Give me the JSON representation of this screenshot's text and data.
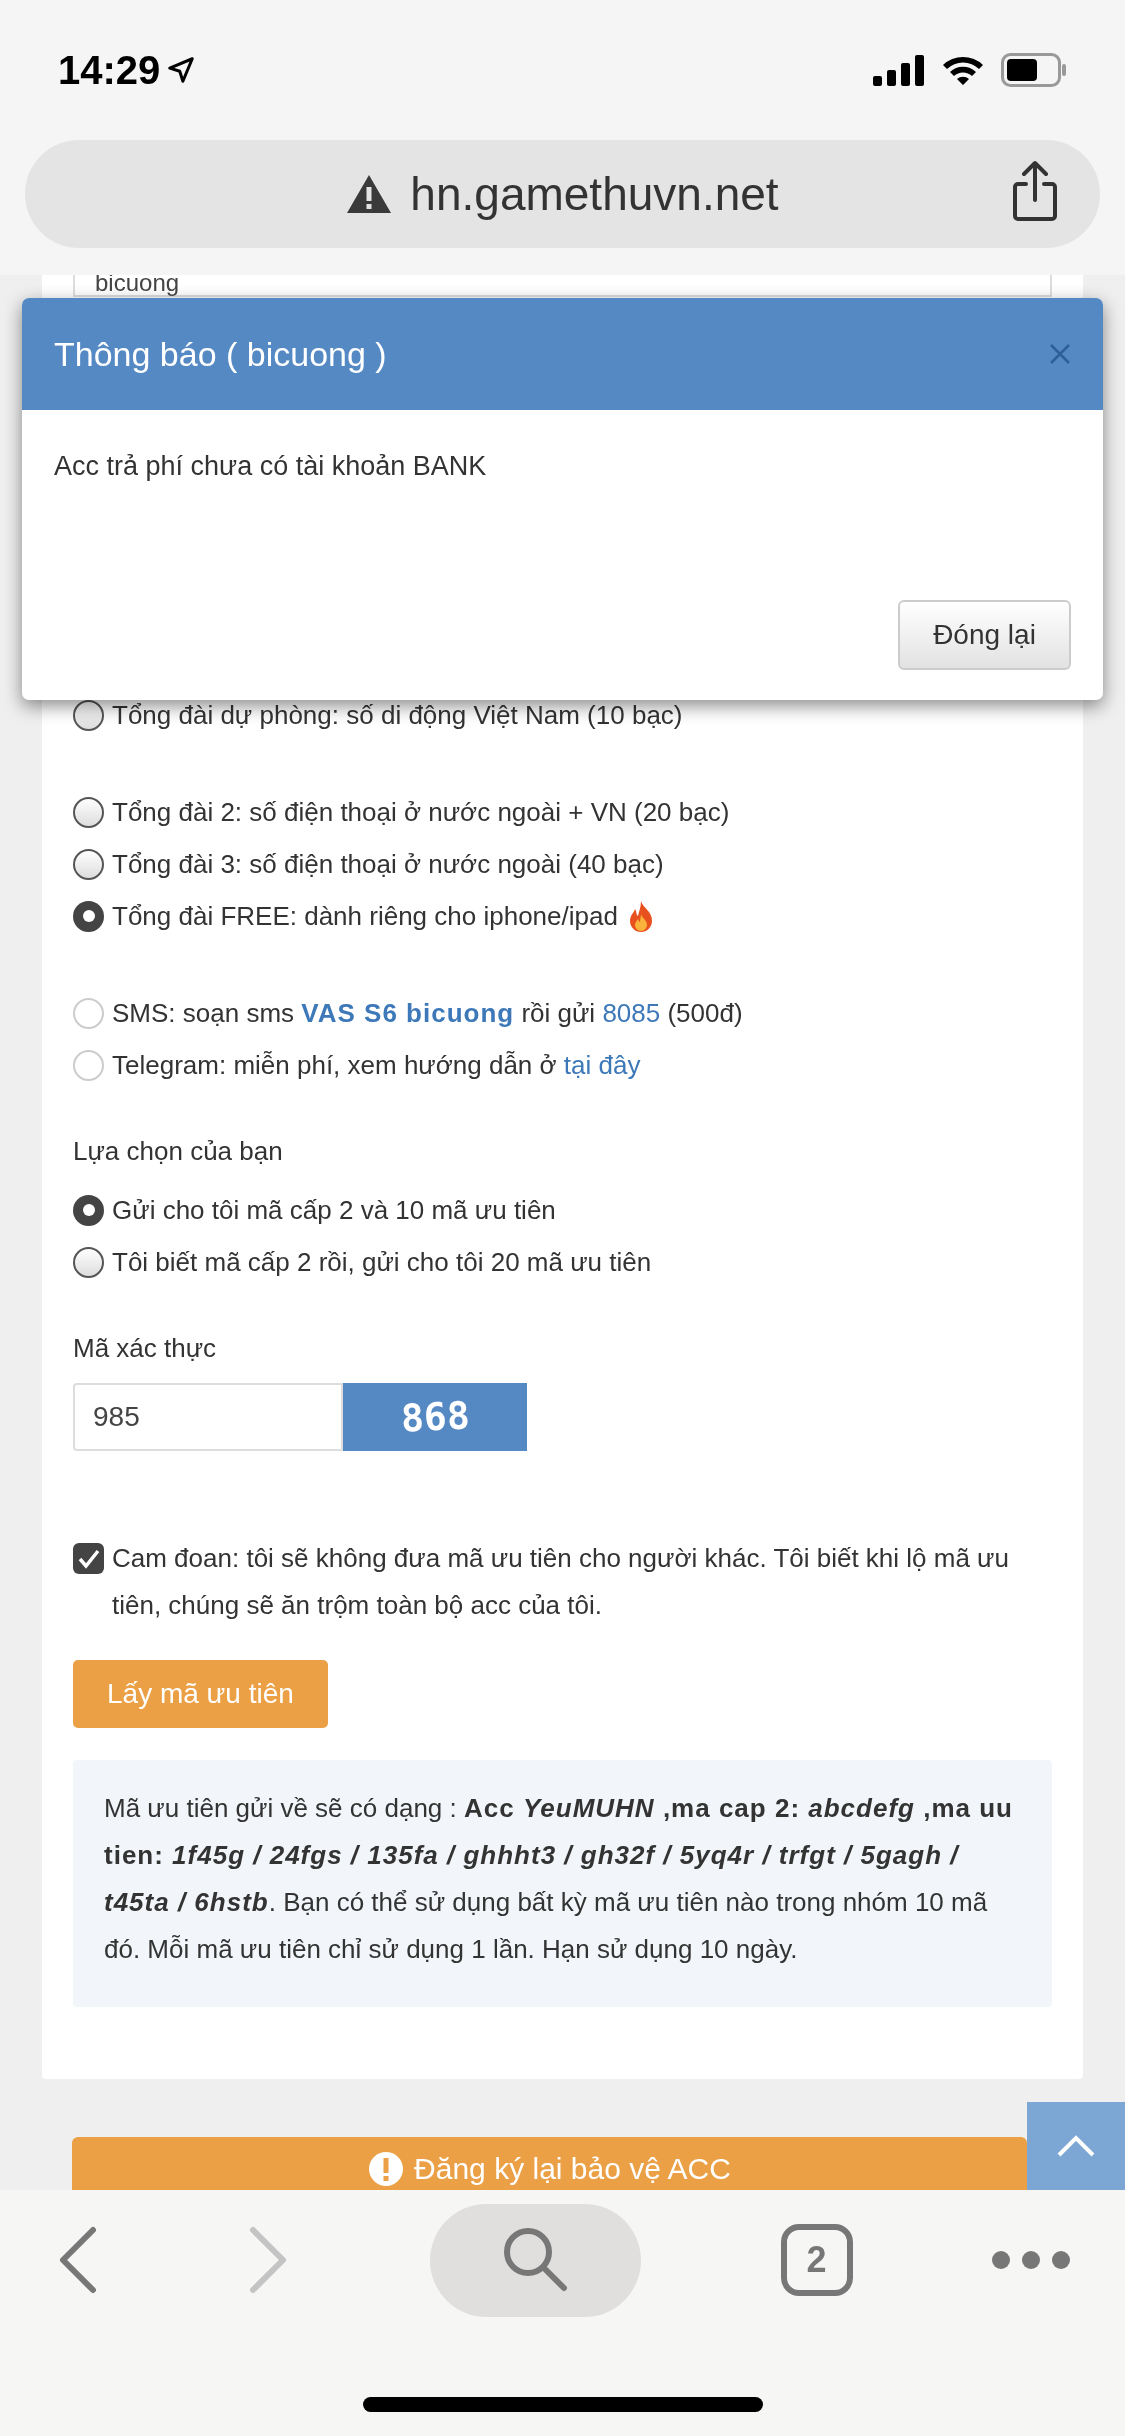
{
  "status_bar": {
    "time": "14:29"
  },
  "address_bar": {
    "url": "hn.gamethuvn.net",
    "insecure": true
  },
  "form": {
    "username_field": {
      "value": "bicuong"
    },
    "hotline_groups": [
      [
        {
          "segments": [
            {
              "kind": "plain",
              "text": "Tổng đài dự phòng: số di động Việt Nam (10 bạc)"
            }
          ],
          "selected": false,
          "disabled": false,
          "hot": false
        }
      ],
      [
        {
          "segments": [
            {
              "kind": "plain",
              "text": "Tổng đài 2: số điện thoại ở nước ngoài + VN (20 bạc)"
            }
          ],
          "selected": false,
          "disabled": false,
          "hot": false
        },
        {
          "segments": [
            {
              "kind": "plain",
              "text": "Tổng đài 3: số điện thoại ở nước ngoài (40 bạc)"
            }
          ],
          "selected": false,
          "disabled": false,
          "hot": false
        },
        {
          "segments": [
            {
              "kind": "plain",
              "text": "Tổng đài FREE: dành riêng cho iphone/ipad"
            }
          ],
          "selected": true,
          "disabled": false,
          "hot": true
        }
      ],
      [
        {
          "segments": [
            {
              "kind": "plain",
              "text": "SMS: soạn sms "
            },
            {
              "kind": "code",
              "text": "VAS S6 bicuong"
            },
            {
              "kind": "plain",
              "text": " rồi gửi "
            },
            {
              "kind": "link",
              "text": "8085"
            },
            {
              "kind": "plain",
              "text": " (500đ)"
            }
          ],
          "selected": false,
          "disabled": true,
          "hot": false
        },
        {
          "segments": [
            {
              "kind": "plain",
              "text": "Telegram: miễn phí, xem hướng dẫn ở "
            },
            {
              "kind": "link",
              "text": "tại đây"
            }
          ],
          "selected": false,
          "disabled": true,
          "hot": false
        }
      ]
    ],
    "choice_label": "Lựa chọn của bạn",
    "choices": [
      {
        "label": "Gửi cho tôi mã cấp 2 và 10 mã ưu tiên",
        "selected": true
      },
      {
        "label": "Tôi biết mã cấp 2 rồi, gửi cho tôi 20 mã ưu tiên",
        "selected": false
      }
    ],
    "captcha_label": "Mã xác thực",
    "captcha_field": {
      "value": "985"
    },
    "captcha_image": "868",
    "pledge": {
      "label": "Cam đoan: tôi sẽ không đưa mã ưu tiên cho người khác. Tôi biết khi lộ mã ưu tiên, chúng sẽ ăn trộm toàn bộ acc của tôi.",
      "checked": true
    },
    "submit_button": "Lấy mã ưu tiên",
    "info": [
      {
        "kind": "plain",
        "text": "Mã ưu tiên gửi về sẽ có dạng : "
      },
      {
        "kind": "bold",
        "text": "Acc "
      },
      {
        "kind": "bold_italic",
        "text": "YeuMUHN"
      },
      {
        "kind": "bold",
        "text": " ,ma cap 2: "
      },
      {
        "kind": "bold_italic",
        "text": "abcdefg"
      },
      {
        "kind": "bold",
        "text": " ,ma uu tien: "
      },
      {
        "kind": "bold_italic",
        "text": "1f45g / 24fgs / 135fa / ghhht3 / gh32f / 5yq4r / trfgt / 5gagh / t45ta / 6hstb"
      },
      {
        "kind": "plain",
        "text": ". Bạn có thể sử dụng bất kỳ mã ưu tiên nào trong nhóm 10 mã đó. Mỗi mã ưu tiên chỉ sử dụng 1 lần. Hạn sử dụng 10 ngày."
      }
    ]
  },
  "register_bar": {
    "label": "Đăng ký lại bảo vệ ACC"
  },
  "dialog": {
    "title": "Thông báo ( bicuong )",
    "message": "Acc trả phí chưa có tài khoản BANK",
    "close_button": "Đóng lại"
  },
  "toolbar": {
    "back_enabled": true,
    "forward_enabled": false,
    "tab_count": "2"
  }
}
